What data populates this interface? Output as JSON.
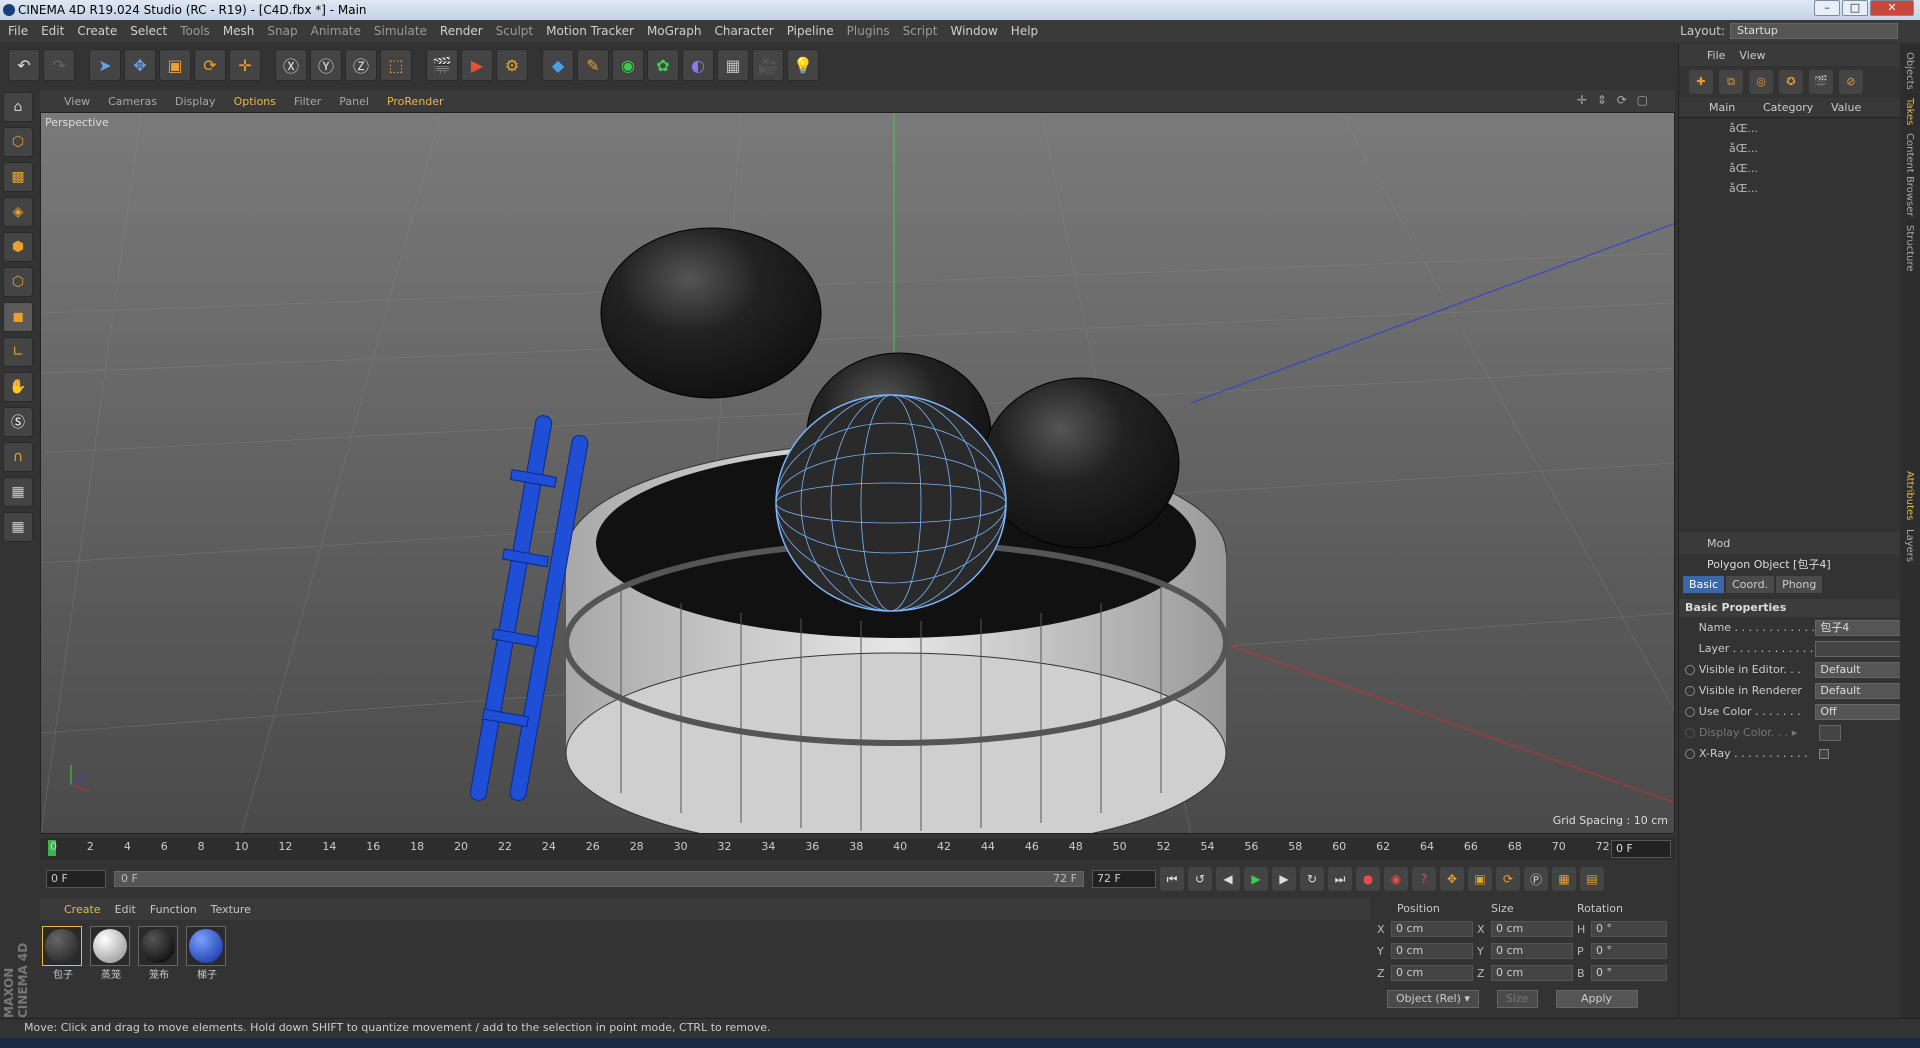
{
  "window": {
    "title": "CINEMA 4D R19.024 Studio (RC - R19) - [C4D.fbx *] - Main",
    "min": "–",
    "max": "□",
    "close": "✕"
  },
  "menu": [
    "File",
    "Edit",
    "Create",
    "Select",
    "Tools",
    "Mesh",
    "Snap",
    "Animate",
    "Simulate",
    "Render",
    "Sculpt",
    "Motion Tracker",
    "MoGraph",
    "Character",
    "Pipeline",
    "Plugins",
    "Script",
    "Window",
    "Help"
  ],
  "layout": {
    "label": "Layout:",
    "value": "Startup"
  },
  "viewport": {
    "menu": [
      "View",
      "Cameras",
      "Display",
      "Options",
      "Filter",
      "Panel",
      "ProRender"
    ],
    "active_menu": "Options",
    "camera_label": "Perspective",
    "grid_spacing": "Grid Spacing : 10 cm",
    "nav": "✛ ⇕ ⟳ ▢"
  },
  "timeline": {
    "frames": [
      "0",
      "2",
      "4",
      "6",
      "8",
      "10",
      "12",
      "14",
      "16",
      "18",
      "20",
      "22",
      "24",
      "26",
      "28",
      "30",
      "32",
      "34",
      "36",
      "38",
      "40",
      "42",
      "44",
      "46",
      "48",
      "50",
      "52",
      "54",
      "56",
      "58",
      "60",
      "62",
      "64",
      "66",
      "68",
      "70",
      "72"
    ],
    "current": "0 F"
  },
  "transport": {
    "start": "0 F",
    "slider_left": "0 F",
    "slider_right": "72 F",
    "end": "72 F"
  },
  "materials": {
    "menu": [
      "Create",
      "Edit",
      "Function",
      "Texture"
    ],
    "active_menu": "Create",
    "items": [
      {
        "name": "包子",
        "color": "#1a1a1a"
      },
      {
        "name": "蒸笼",
        "color": "#b8b8b8"
      },
      {
        "name": "笼布",
        "color": "#111111"
      },
      {
        "name": "梯子",
        "color": "#1f4fd6"
      }
    ]
  },
  "coords": {
    "headers": [
      "Position",
      "Size",
      "Rotation"
    ],
    "rows": [
      {
        "a": "X",
        "pos": "0 cm",
        "b": "X",
        "size": "0 cm",
        "c": "H",
        "rot": "0 °"
      },
      {
        "a": "Y",
        "pos": "0 cm",
        "b": "Y",
        "size": "0 cm",
        "c": "P",
        "rot": "0 °"
      },
      {
        "a": "Z",
        "pos": "0 cm",
        "b": "Z",
        "size": "0 cm",
        "c": "B",
        "rot": "0 °"
      }
    ],
    "mode": "Object (Rel) ▾",
    "size_mode": "Size",
    "apply": "Apply"
  },
  "objects": {
    "menu": [
      "File",
      "View"
    ],
    "columns": [
      "Main",
      "Category",
      "Value"
    ],
    "rows": [
      "åŒ...",
      "åŒ...",
      "åŒ...",
      "åŒ..."
    ]
  },
  "attributes": {
    "menu": "Mod",
    "object": "Polygon Object [包子4]",
    "tabs": [
      "Basic",
      "Coord.",
      "Phong"
    ],
    "section": "Basic Properties",
    "name_label": "Name . . . . . . . . . . . .",
    "name_value": "包子4",
    "layer_label": "Layer . . . . . . . . . . . .",
    "vis_editor_label": "Visible in Editor. . .",
    "vis_editor_value": "Default",
    "vis_render_label": "Visible in Renderer",
    "vis_render_value": "Default",
    "use_color_label": "Use Color . . . . . . .",
    "use_color_value": "Off",
    "display_color_label": "Display Color. . . ▸",
    "xray_label": "X-Ray . . . . . . . . . . ."
  },
  "side_tabs": [
    "Objects",
    "Takes",
    "Content Browser",
    "Structure",
    "Attributes",
    "Layers"
  ],
  "status": "Move: Click and drag to move elements. Hold down SHIFT to quantize movement / add to the selection in point mode, CTRL to remove.",
  "brand": "MAXON CINEMA 4D"
}
